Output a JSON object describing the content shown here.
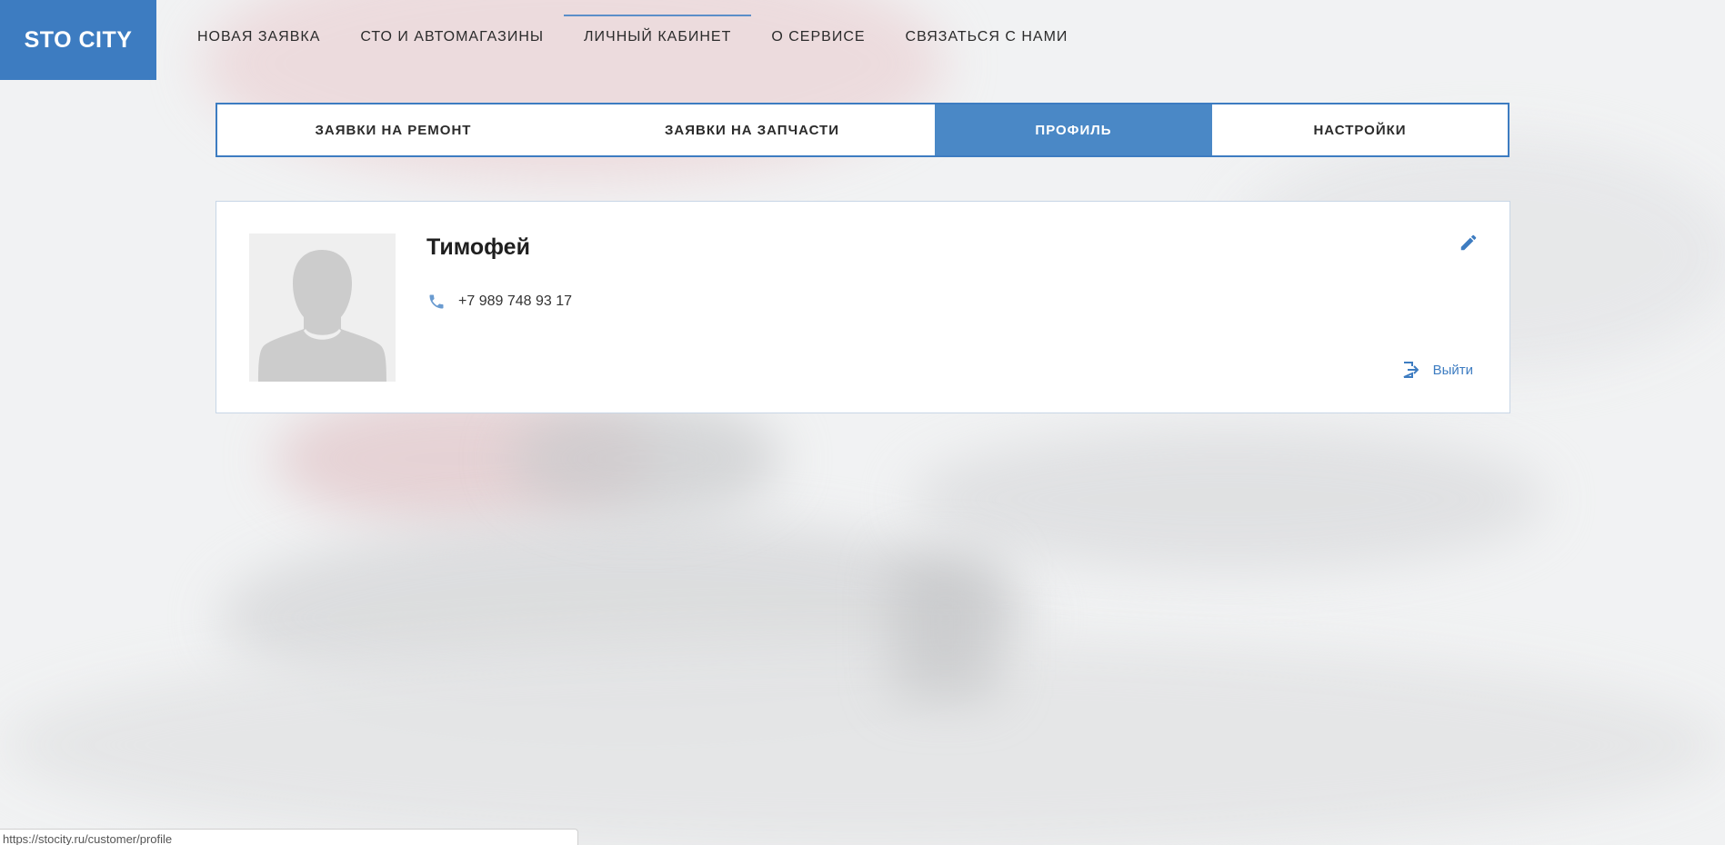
{
  "header": {
    "logo": "STO CITY",
    "nav": [
      {
        "label": "НОВАЯ ЗАЯВКА",
        "active": false
      },
      {
        "label": "СТО И АВТОМАГАЗИНЫ",
        "active": false
      },
      {
        "label": "ЛИЧНЫЙ КАБИНЕТ",
        "active": true
      },
      {
        "label": "О СЕРВИСЕ",
        "active": false
      },
      {
        "label": "СВЯЗАТЬСЯ С НАМИ",
        "active": false
      }
    ]
  },
  "tabs": [
    {
      "label": "ЗАЯВКИ НА РЕМОНТ",
      "active": false
    },
    {
      "label": "ЗАЯВКИ НА ЗАПЧАСТИ",
      "active": false
    },
    {
      "label": "ПРОФИЛЬ",
      "active": true
    },
    {
      "label": "НАСТРОЙКИ",
      "active": false
    }
  ],
  "profile": {
    "name": "Тимофей",
    "phone": "+7 989 748 93 17",
    "logout_label": "Выйти",
    "icons": {
      "avatar": "user-placeholder",
      "phone": "phone-icon",
      "edit": "pencil-icon",
      "logout": "logout-icon"
    }
  },
  "statusbar": {
    "url": "https://stocity.ru/customer/profile"
  },
  "colors": {
    "brand": "#3d7cc1",
    "active_tab": "#4a88c6"
  }
}
